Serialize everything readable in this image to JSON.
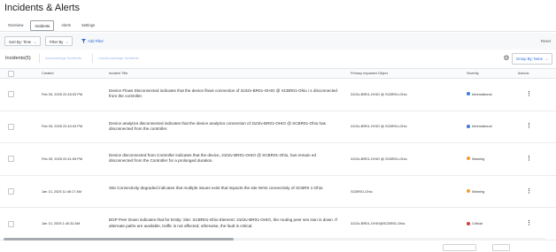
{
  "page": {
    "title": "Incidents & Alerts"
  },
  "tabs": [
    "Overview",
    "Incidents",
    "Alerts",
    "Settings"
  ],
  "filters": {
    "sort_by": "Sort By: Time",
    "filter_by": "Filter By",
    "add_filter": "Add Filter",
    "reset": "Reset"
  },
  "toolbar": {
    "count": "Incidents(5)",
    "acknowledge": "Acknowledge Incidents",
    "unacknowledge": "Unacknowledge Incidents",
    "group_by": "Group By: None"
  },
  "columns": {
    "created": "Created",
    "incident_title": "Incident Title",
    "primary_object": "Primary Impacted Object",
    "severity": "Severity",
    "actions": "Actions"
  },
  "severity_colors": {
    "Informational": "#3b7ddd",
    "Warning": "#f0a030",
    "Critical": "#d93a3a"
  },
  "rows": [
    {
      "created": "Feb 05, 2025 22:45:03 PM",
      "title": "Device Flows Disconnected indicates that the device flows connection of 3102v-BR01-OHIO @ SCBR01-Ohio i s disconnected from the controller.",
      "object": "3102v-BR01-OHIO @ SCBR01-Ohio",
      "severity": "Informational",
      "icon": "info-icon"
    },
    {
      "created": "Feb 05, 2025 22:40:03 PM",
      "title": "Device analytics disconnected indicates that the device analytics connection of 3102v-BR01-OHIO @ SCBR01-Ohio has disconnected from the controller.",
      "object": "3102v-BR01-OHIO @ SCBR01-Ohio",
      "severity": "Informational",
      "icon": "info-icon"
    },
    {
      "created": "Feb 05, 2025 22:41:05 PM",
      "title": "Device disconnected from Controller indicates that the device, 3102v-BR01-OHIO @ SCBR01-Ohio, has remain ed disconnected from the Controller for a prolonged duration.",
      "object": "3102v-BR01-OHIO @ SCBR01-Ohio",
      "severity": "Warning",
      "icon": "warning-icon"
    },
    {
      "created": "Jan 13, 2025 11:46:17 AM",
      "title": "Site Connectivity degraded indicates that multiple issues exist that impacts the site WAN connectivity of SCBR0 1-Ohio.",
      "object": "SCBR01-Ohio",
      "severity": "Warning",
      "icon": "warning-icon"
    },
    {
      "created": "Jan 13, 2025 1:40:32 AM",
      "title": "BGP Peer Down indicates that for Entity: Site: SCBR01-Ohio Element: 3102v-BR01-OHIO, the routing peer ses sion is down. If alternate paths are available, traffic is not affected; otherwise, the fault is critical.",
      "object": "3102v-BR01-OHIO@SCBR01-Ohio",
      "severity": "Critical",
      "icon": "critical-icon"
    }
  ]
}
